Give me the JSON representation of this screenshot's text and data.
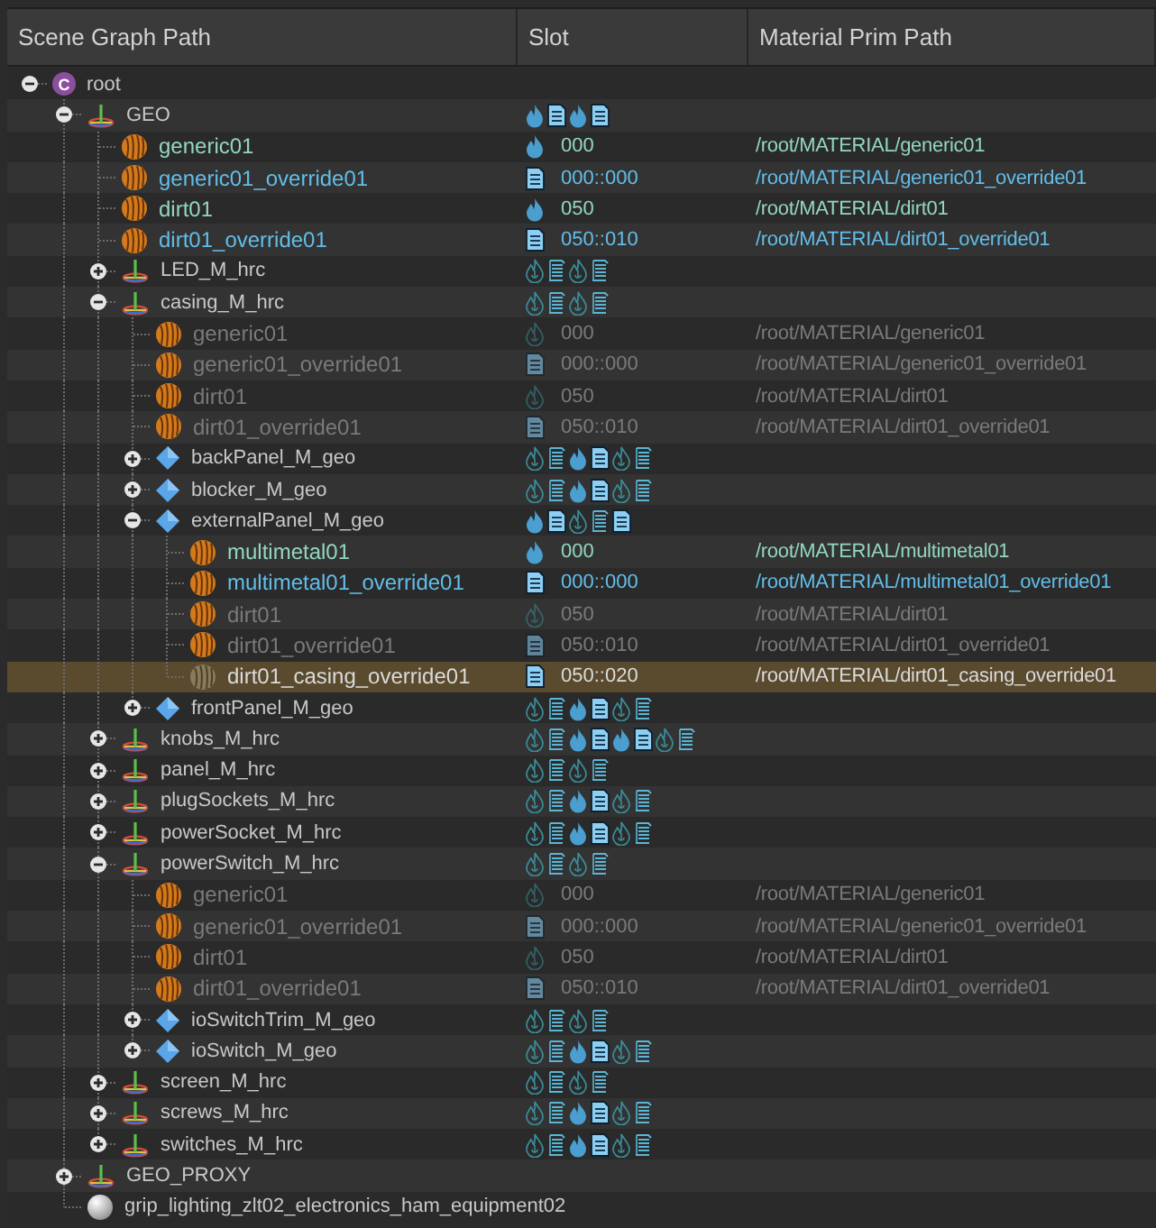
{
  "columns": [
    "Scene Graph Path",
    "Slot",
    "Material Prim Path"
  ],
  "tree": [
    {
      "name": "root",
      "kind": "root",
      "badge": "C",
      "expanded": true,
      "selected": false,
      "children": [
        {
          "name": "GEO",
          "kind": "group",
          "expanded": true,
          "selected": false,
          "slot_icons": [
            {
              "kind": "flame",
              "filled": true
            },
            {
              "kind": "doc",
              "filled": true
            },
            {
              "kind": "flame",
              "filled": true
            },
            {
              "kind": "doc",
              "filled": true
            }
          ],
          "children": [
            {
              "name": "generic01",
              "kind": "material",
              "active": true,
              "selected": false,
              "slot": "000",
              "path": "/root/MATERIAL/generic01"
            },
            {
              "name": "generic01_override01",
              "kind": "override",
              "active": true,
              "selected": false,
              "slot": "000::000",
              "path": "/root/MATERIAL/generic01_override01"
            },
            {
              "name": "dirt01",
              "kind": "material",
              "active": true,
              "selected": false,
              "slot": "050",
              "path": "/root/MATERIAL/dirt01"
            },
            {
              "name": "dirt01_override01",
              "kind": "override",
              "active": true,
              "selected": false,
              "slot": "050::010",
              "path": "/root/MATERIAL/dirt01_override01"
            },
            {
              "name": "LED_M_hrc",
              "kind": "group",
              "expanded": false,
              "selected": false,
              "slot_icons": [
                {
                  "kind": "flame",
                  "filled": false
                },
                {
                  "kind": "doc",
                  "filled": false
                },
                {
                  "kind": "flame",
                  "filled": false
                },
                {
                  "kind": "doc",
                  "filled": false
                }
              ]
            },
            {
              "name": "casing_M_hrc",
              "kind": "group",
              "expanded": true,
              "selected": false,
              "slot_icons": [
                {
                  "kind": "flame",
                  "filled": false
                },
                {
                  "kind": "doc",
                  "filled": false
                },
                {
                  "kind": "flame",
                  "filled": false
                },
                {
                  "kind": "doc",
                  "filled": false
                }
              ],
              "children": [
                {
                  "name": "generic01",
                  "kind": "material",
                  "active": false,
                  "selected": false,
                  "slot": "000",
                  "path": "/root/MATERIAL/generic01"
                },
                {
                  "name": "generic01_override01",
                  "kind": "override",
                  "active": false,
                  "selected": false,
                  "slot": "000::000",
                  "path": "/root/MATERIAL/generic01_override01"
                },
                {
                  "name": "dirt01",
                  "kind": "material",
                  "active": false,
                  "selected": false,
                  "slot": "050",
                  "path": "/root/MATERIAL/dirt01"
                },
                {
                  "name": "dirt01_override01",
                  "kind": "override",
                  "active": false,
                  "selected": false,
                  "slot": "050::010",
                  "path": "/root/MATERIAL/dirt01_override01"
                },
                {
                  "name": "backPanel_M_geo",
                  "kind": "geo",
                  "expanded": false,
                  "selected": false,
                  "slot_icons": [
                    {
                      "kind": "flame",
                      "filled": false
                    },
                    {
                      "kind": "doc",
                      "filled": false
                    },
                    {
                      "kind": "flame",
                      "filled": true
                    },
                    {
                      "kind": "doc",
                      "filled": true
                    },
                    {
                      "kind": "flame",
                      "filled": false
                    },
                    {
                      "kind": "doc",
                      "filled": false
                    }
                  ]
                },
                {
                  "name": "blocker_M_geo",
                  "kind": "geo",
                  "expanded": false,
                  "selected": false,
                  "slot_icons": [
                    {
                      "kind": "flame",
                      "filled": false
                    },
                    {
                      "kind": "doc",
                      "filled": false
                    },
                    {
                      "kind": "flame",
                      "filled": true
                    },
                    {
                      "kind": "doc",
                      "filled": true
                    },
                    {
                      "kind": "flame",
                      "filled": false
                    },
                    {
                      "kind": "doc",
                      "filled": false
                    }
                  ]
                },
                {
                  "name": "externalPanel_M_geo",
                  "kind": "geo",
                  "expanded": true,
                  "selected": false,
                  "slot_icons": [
                    {
                      "kind": "flame",
                      "filled": true
                    },
                    {
                      "kind": "doc",
                      "filled": true
                    },
                    {
                      "kind": "flame",
                      "filled": false
                    },
                    {
                      "kind": "doc",
                      "filled": false
                    },
                    {
                      "kind": "doc",
                      "filled": true
                    }
                  ],
                  "children": [
                    {
                      "name": "multimetal01",
                      "kind": "material",
                      "active": true,
                      "selected": false,
                      "slot": "000",
                      "path": "/root/MATERIAL/multimetal01"
                    },
                    {
                      "name": "multimetal01_override01",
                      "kind": "override",
                      "active": true,
                      "selected": false,
                      "slot": "000::000",
                      "path": "/root/MATERIAL/multimetal01_override01"
                    },
                    {
                      "name": "dirt01",
                      "kind": "material",
                      "active": false,
                      "selected": false,
                      "slot": "050",
                      "path": "/root/MATERIAL/dirt01"
                    },
                    {
                      "name": "dirt01_override01",
                      "kind": "override",
                      "active": false,
                      "selected": false,
                      "slot": "050::010",
                      "path": "/root/MATERIAL/dirt01_override01"
                    },
                    {
                      "name": "dirt01_casing_override01",
                      "kind": "override",
                      "active": true,
                      "selected": true,
                      "slot": "050::020",
                      "path": "/root/MATERIAL/dirt01_casing_override01"
                    }
                  ]
                },
                {
                  "name": "frontPanel_M_geo",
                  "kind": "geo",
                  "expanded": false,
                  "selected": false,
                  "slot_icons": [
                    {
                      "kind": "flame",
                      "filled": false
                    },
                    {
                      "kind": "doc",
                      "filled": false
                    },
                    {
                      "kind": "flame",
                      "filled": true
                    },
                    {
                      "kind": "doc",
                      "filled": true
                    },
                    {
                      "kind": "flame",
                      "filled": false
                    },
                    {
                      "kind": "doc",
                      "filled": false
                    }
                  ]
                }
              ]
            },
            {
              "name": "knobs_M_hrc",
              "kind": "group",
              "expanded": false,
              "selected": false,
              "slot_icons": [
                {
                  "kind": "flame",
                  "filled": false
                },
                {
                  "kind": "doc",
                  "filled": false
                },
                {
                  "kind": "flame",
                  "filled": true
                },
                {
                  "kind": "doc",
                  "filled": true
                },
                {
                  "kind": "flame",
                  "filled": true
                },
                {
                  "kind": "doc",
                  "filled": true
                },
                {
                  "kind": "flame",
                  "filled": false
                },
                {
                  "kind": "doc",
                  "filled": false
                }
              ]
            },
            {
              "name": "panel_M_hrc",
              "kind": "group",
              "expanded": false,
              "selected": false,
              "slot_icons": [
                {
                  "kind": "flame",
                  "filled": false
                },
                {
                  "kind": "doc",
                  "filled": false
                },
                {
                  "kind": "flame",
                  "filled": false
                },
                {
                  "kind": "doc",
                  "filled": false
                }
              ]
            },
            {
              "name": "plugSockets_M_hrc",
              "kind": "group",
              "expanded": false,
              "selected": false,
              "slot_icons": [
                {
                  "kind": "flame",
                  "filled": false
                },
                {
                  "kind": "doc",
                  "filled": false
                },
                {
                  "kind": "flame",
                  "filled": true
                },
                {
                  "kind": "doc",
                  "filled": true
                },
                {
                  "kind": "flame",
                  "filled": false
                },
                {
                  "kind": "doc",
                  "filled": false
                }
              ]
            },
            {
              "name": "powerSocket_M_hrc",
              "kind": "group",
              "expanded": false,
              "selected": false,
              "slot_icons": [
                {
                  "kind": "flame",
                  "filled": false
                },
                {
                  "kind": "doc",
                  "filled": false
                },
                {
                  "kind": "flame",
                  "filled": true
                },
                {
                  "kind": "doc",
                  "filled": true
                },
                {
                  "kind": "flame",
                  "filled": false
                },
                {
                  "kind": "doc",
                  "filled": false
                }
              ]
            },
            {
              "name": "powerSwitch_M_hrc",
              "kind": "group",
              "expanded": true,
              "selected": false,
              "slot_icons": [
                {
                  "kind": "flame",
                  "filled": false
                },
                {
                  "kind": "doc",
                  "filled": false
                },
                {
                  "kind": "flame",
                  "filled": false
                },
                {
                  "kind": "doc",
                  "filled": false
                }
              ],
              "children": [
                {
                  "name": "generic01",
                  "kind": "material",
                  "active": false,
                  "selected": false,
                  "slot": "000",
                  "path": "/root/MATERIAL/generic01"
                },
                {
                  "name": "generic01_override01",
                  "kind": "override",
                  "active": false,
                  "selected": false,
                  "slot": "000::000",
                  "path": "/root/MATERIAL/generic01_override01"
                },
                {
                  "name": "dirt01",
                  "kind": "material",
                  "active": false,
                  "selected": false,
                  "slot": "050",
                  "path": "/root/MATERIAL/dirt01"
                },
                {
                  "name": "dirt01_override01",
                  "kind": "override",
                  "active": false,
                  "selected": false,
                  "slot": "050::010",
                  "path": "/root/MATERIAL/dirt01_override01"
                },
                {
                  "name": "ioSwitchTrim_M_geo",
                  "kind": "geo",
                  "expanded": false,
                  "selected": false,
                  "slot_icons": [
                    {
                      "kind": "flame",
                      "filled": false
                    },
                    {
                      "kind": "doc",
                      "filled": false
                    },
                    {
                      "kind": "flame",
                      "filled": false
                    },
                    {
                      "kind": "doc",
                      "filled": false
                    }
                  ]
                },
                {
                  "name": "ioSwitch_M_geo",
                  "kind": "geo",
                  "expanded": false,
                  "selected": false,
                  "slot_icons": [
                    {
                      "kind": "flame",
                      "filled": false
                    },
                    {
                      "kind": "doc",
                      "filled": false
                    },
                    {
                      "kind": "flame",
                      "filled": true
                    },
                    {
                      "kind": "doc",
                      "filled": true
                    },
                    {
                      "kind": "flame",
                      "filled": false
                    },
                    {
                      "kind": "doc",
                      "filled": false
                    }
                  ]
                }
              ]
            },
            {
              "name": "screen_M_hrc",
              "kind": "group",
              "expanded": false,
              "selected": false,
              "slot_icons": [
                {
                  "kind": "flame",
                  "filled": false
                },
                {
                  "kind": "doc",
                  "filled": false
                },
                {
                  "kind": "flame",
                  "filled": false
                },
                {
                  "kind": "doc",
                  "filled": false
                }
              ]
            },
            {
              "name": "screws_M_hrc",
              "kind": "group",
              "expanded": false,
              "selected": false,
              "slot_icons": [
                {
                  "kind": "flame",
                  "filled": false
                },
                {
                  "kind": "doc",
                  "filled": false
                },
                {
                  "kind": "flame",
                  "filled": true
                },
                {
                  "kind": "doc",
                  "filled": true
                },
                {
                  "kind": "flame",
                  "filled": false
                },
                {
                  "kind": "doc",
                  "filled": false
                }
              ]
            },
            {
              "name": "switches_M_hrc",
              "kind": "group",
              "expanded": false,
              "selected": false,
              "slot_icons": [
                {
                  "kind": "flame",
                  "filled": false
                },
                {
                  "kind": "doc",
                  "filled": false
                },
                {
                  "kind": "flame",
                  "filled": true
                },
                {
                  "kind": "doc",
                  "filled": true
                },
                {
                  "kind": "flame",
                  "filled": false
                },
                {
                  "kind": "doc",
                  "filled": false
                }
              ]
            }
          ]
        },
        {
          "name": "GEO_PROXY",
          "kind": "group",
          "expanded": false,
          "selected": false
        },
        {
          "name": "grip_lighting_zlt02_electronics_ham_equipment02",
          "kind": "light",
          "selected": false
        }
      ]
    }
  ]
}
